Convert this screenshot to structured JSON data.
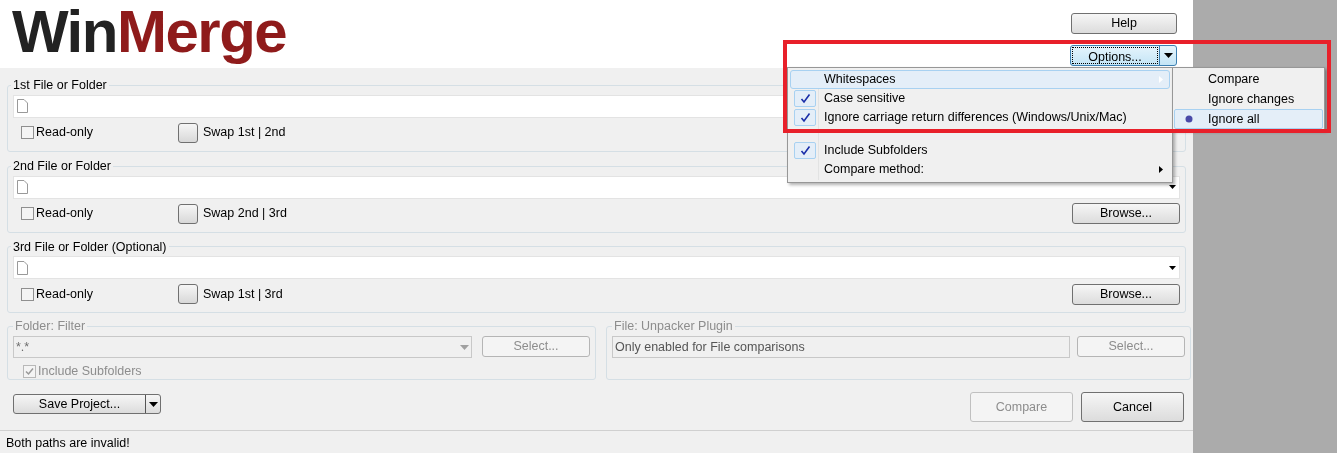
{
  "logo": {
    "part_1": "Win",
    "part_2": "Merge"
  },
  "help_button": "Help",
  "options_button": "Options...",
  "options_menu": [
    {
      "label": "Whitespaces",
      "kind": "submenu",
      "highlighted": true
    },
    {
      "label": "Case sensitive",
      "kind": "check",
      "checked": true,
      "highlighted": false
    },
    {
      "label": "Ignore carriage return differences (Windows/Unix/Mac)",
      "kind": "check",
      "checked": true,
      "highlighted": false
    },
    {
      "label": "Include Subfolders",
      "kind": "check",
      "checked": true,
      "highlighted": false
    },
    {
      "label": "Compare method:",
      "kind": "submenu",
      "highlighted": false
    }
  ],
  "whitespaces_submenu": [
    {
      "label": "Compare",
      "selected": false
    },
    {
      "label": "Ignore changes",
      "selected": false
    },
    {
      "label": "Ignore all",
      "selected": true
    }
  ],
  "path_groups": [
    {
      "title": "1st File or Folder",
      "read_only": {
        "label": "Read-only",
        "checked": false
      },
      "swap_button": "Swap 1st | 2nd"
    },
    {
      "title": "2nd File or Folder",
      "read_only": {
        "label": "Read-only",
        "checked": false
      },
      "swap_button": "Swap 2nd | 3rd",
      "browse_button": "Browse..."
    },
    {
      "title": "3rd File or Folder (Optional)",
      "read_only": {
        "label": "Read-only",
        "checked": false
      },
      "swap_button": "Swap 1st | 3rd",
      "browse_button": "Browse..."
    }
  ],
  "folder_filter": {
    "title": "Folder: Filter",
    "value": "*.*",
    "select_button": "Select...",
    "include_subfolders": {
      "label": "Include Subfolders",
      "checked": true
    },
    "disabled": true
  },
  "unpacker_plugin": {
    "title": "File: Unpacker Plugin",
    "value": "Only enabled for File comparisons",
    "select_button": "Select...",
    "disabled": true
  },
  "save_project_button": "Save Project...",
  "compare_button": {
    "label": "Compare",
    "disabled": true
  },
  "cancel_button": "Cancel",
  "status_bar": "Both paths are invalid!"
}
